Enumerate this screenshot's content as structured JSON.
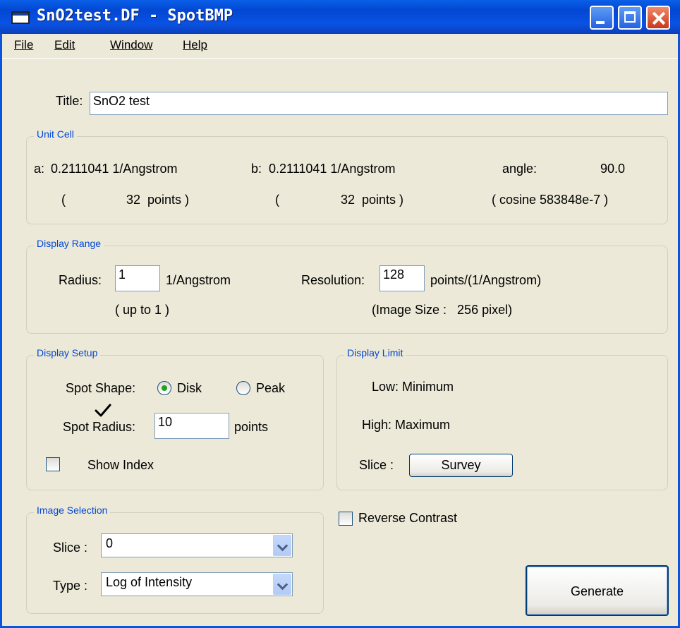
{
  "window": {
    "title": "SnO2test.DF - SpotBMP"
  },
  "menu": [
    "File",
    "Edit",
    "Window",
    "Help"
  ],
  "title_field": {
    "label": "Title:",
    "value": "SnO2 test"
  },
  "unit_cell": {
    "group_title": "Unit Cell",
    "a_label": "a:",
    "a_value": "0.2111041 1/Angstrom",
    "b_label": "b:",
    "b_value": "0.2111041 1/Angstrom",
    "angle_label": "angle:",
    "angle_value": "90.0",
    "a_points_open": "(",
    "a_points": "32  points )",
    "b_points_open": "(",
    "b_points": "32  points )",
    "cosine": "( cosine 583848e-7 )"
  },
  "display_range": {
    "group_title": "Display Range",
    "radius_label": "Radius:",
    "radius_value": "1",
    "radius_unit": "1/Angstrom",
    "radius_hint": "( up to 1 )",
    "resolution_label": "Resolution:",
    "resolution_value": "128",
    "resolution_unit": "points/(1/Angstrom)",
    "image_size": "(Image Size :   256 pixel)"
  },
  "display_setup": {
    "group_title": "Display Setup",
    "shape_label": "Spot Shape:",
    "shape_disk": "Disk",
    "shape_peak": "Peak",
    "shape_selected": "Disk",
    "spot_radius_label": "Spot Radius:",
    "spot_radius_value": "10",
    "spot_radius_unit": "points",
    "show_index_label": "Show Index",
    "show_index_checked": false
  },
  "display_limit": {
    "group_title": "Display Limit",
    "low": "Low: Minimum",
    "high": "High: Maximum",
    "slice_label": "Slice :",
    "survey_button": "Survey"
  },
  "reverse_contrast": {
    "label": "Reverse Contrast",
    "checked": false
  },
  "image_selection": {
    "group_title": "Image Selection",
    "slice_label": "Slice :",
    "slice_value": "0",
    "type_label": "Type :",
    "type_value": "Log of Intensity"
  },
  "generate_button": "Generate"
}
